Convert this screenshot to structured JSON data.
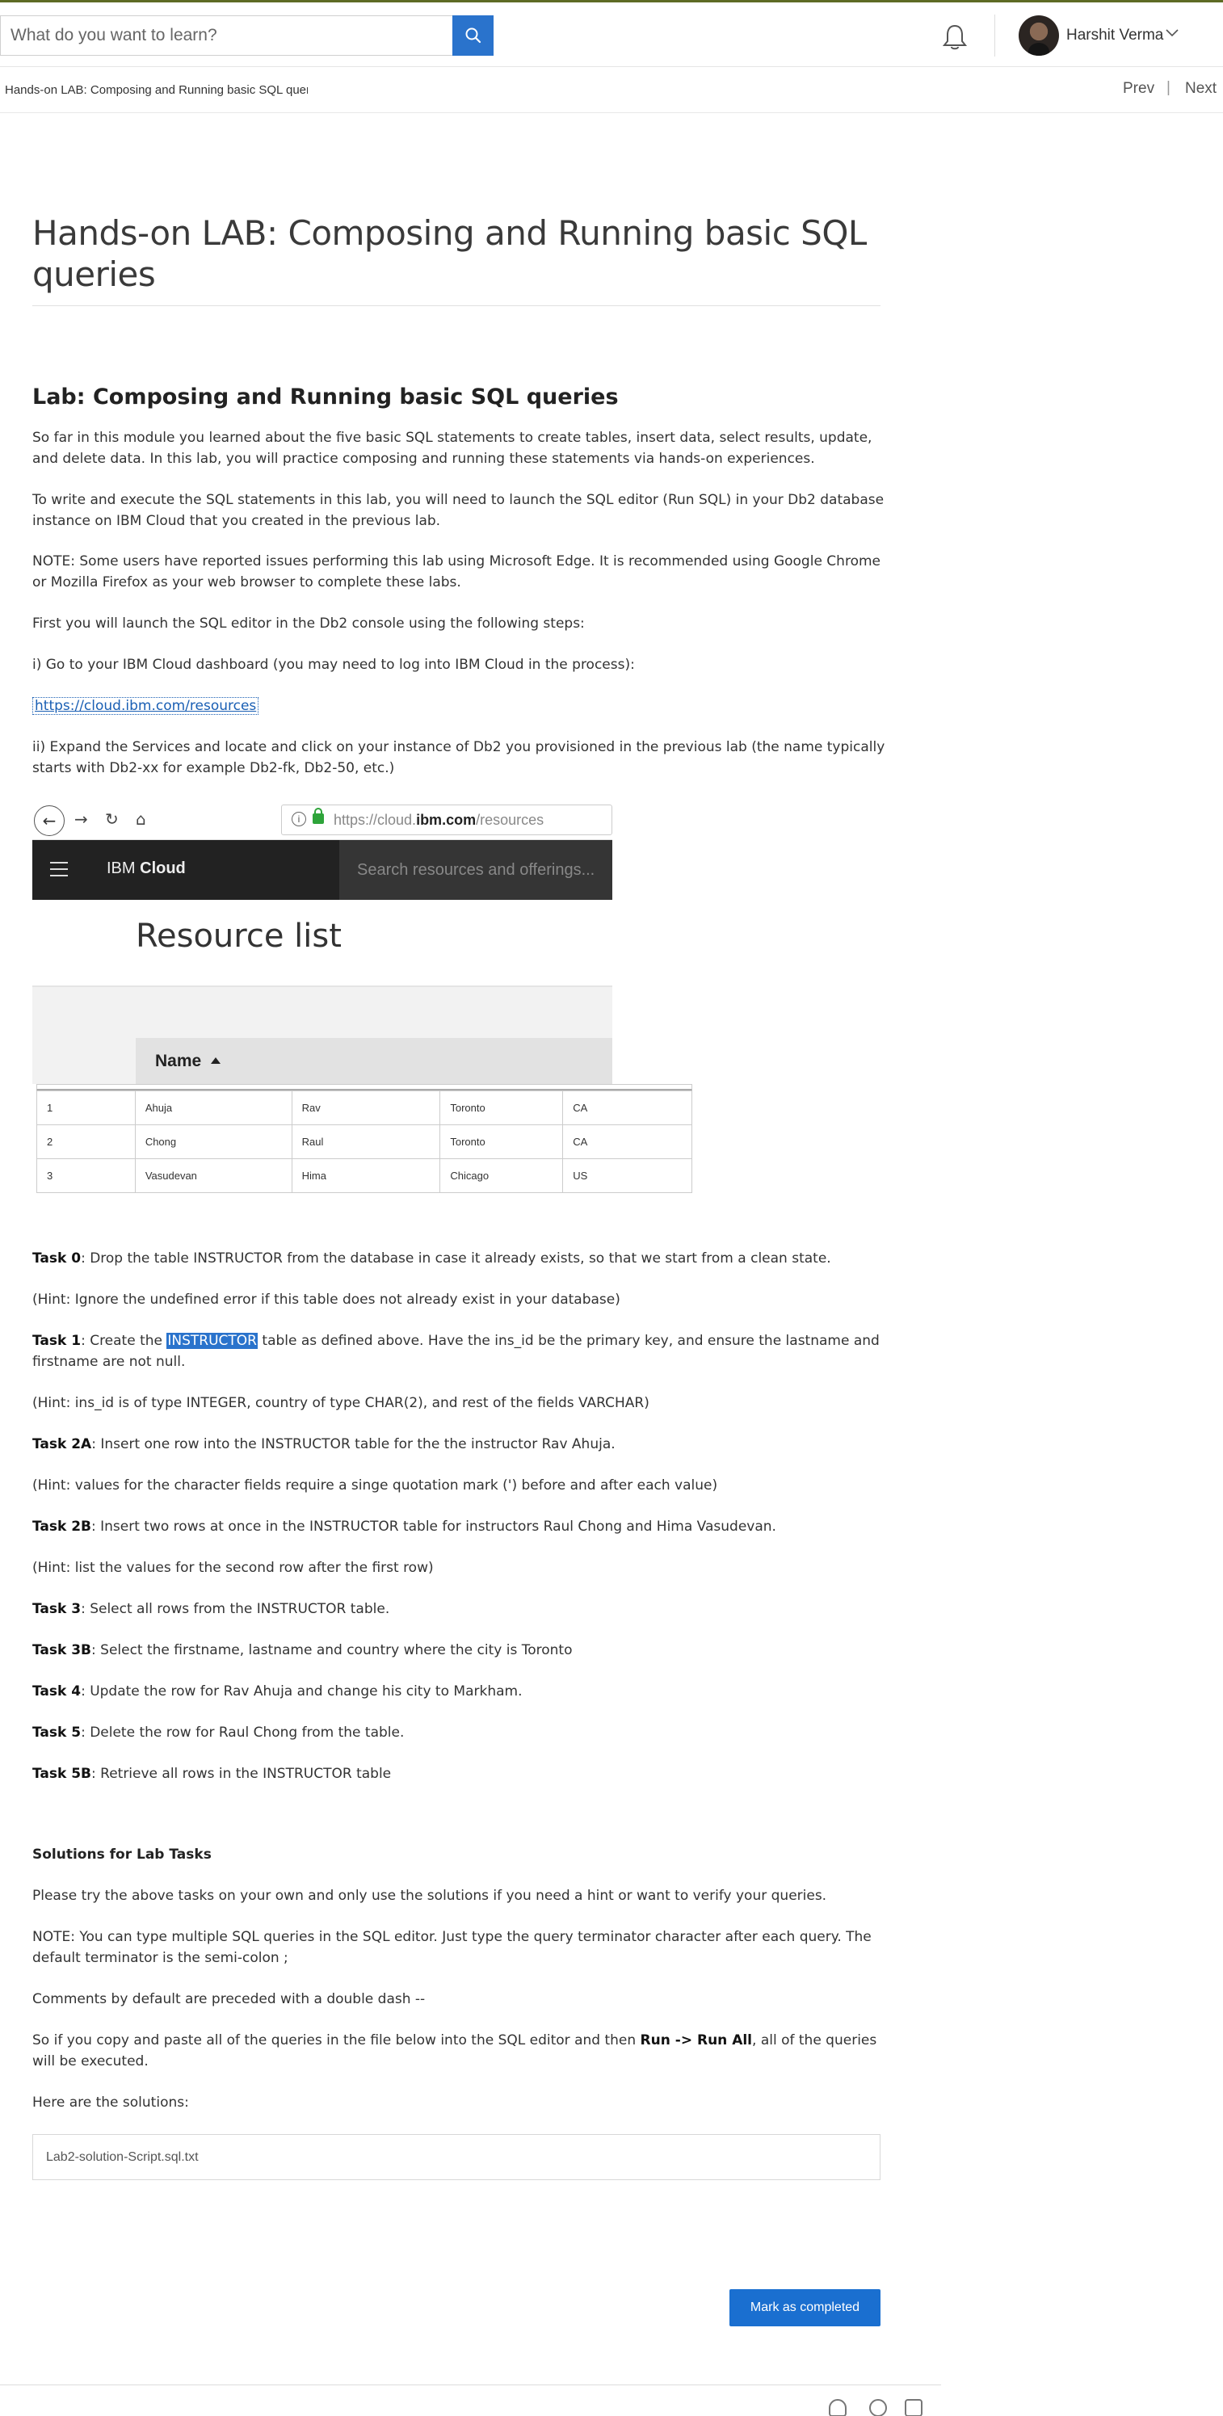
{
  "header": {
    "search_placeholder": "What do you want to learn?",
    "user_name": "Harshit Verma"
  },
  "subbar": {
    "breadcrumb": "Hands-on LAB: Composing and Running basic SQL queries",
    "prev": "Prev",
    "separator": "|",
    "next": "Next"
  },
  "page": {
    "title": "Hands-on LAB: Composing and Running basic SQL queries",
    "lab_heading": "Lab: Composing and Running basic SQL queries",
    "intro": "So far in this module you learned about the five basic SQL statements to create tables, insert data, select results, update, and delete data. In this lab, you will practice composing and running these statements via hands-on experiences.",
    "launch_note": "To write and execute the SQL statements in this lab, you will need to launch the SQL editor (Run SQL) in your Db2 database instance on IBM Cloud that you created in the previous lab.",
    "edge_note": "NOTE: Some users have reported issues performing this lab using Microsoft Edge. It is recommended using Google Chrome or Mozilla Firefox as your web browser to complete these labs.",
    "first_steps": "First you will launch the SQL editor in the Db2 console using the following steps:",
    "step1": "i) Go to your IBM Cloud dashboard (you may need to log into IBM Cloud in the process):",
    "step1_link": "https://cloud.ibm.com/resources",
    "step2": "ii) Expand the Services and locate and click on your instance of Db2 you provisioned in the previous lab (the name typically starts with Db2-xx for example Db2-fk, Db2-50, etc.)"
  },
  "figure": {
    "url_prefix": "https://cloud.",
    "url_bold": "ibm.com",
    "url_suffix": "/resources",
    "brand_prefix": "IBM ",
    "brand_bold": "Cloud",
    "search_placeholder": "Search resources and offerings...",
    "resource_list_title": "Resource list",
    "name_column": "Name",
    "table_rows": [
      [
        "1",
        "Ahuja",
        "Rav",
        "Toronto",
        "CA"
      ],
      [
        "2",
        "Chong",
        "Raul",
        "Toronto",
        "CA"
      ],
      [
        "3",
        "Vasudevan",
        "Hima",
        "Chicago",
        "US"
      ]
    ]
  },
  "tasks": {
    "t0_label": "Task 0",
    "t0_text": ": Drop the table INSTRUCTOR from the database in case it already exists, so that we start from a clean state.",
    "t0_hint": "(Hint: Ignore the undefined error if this table does not already exist in your database)",
    "t1_label": "Task 1",
    "t1_pre": ": Create the ",
    "t1_highlight": "INSTRUCTOR",
    "t1_post": " table as defined above. Have the ins_id be the primary key, and ensure the lastname and firstname are not null.",
    "t1_hint": "(Hint: ins_id is of type INTEGER, country of type CHAR(2), and rest of the fields VARCHAR)",
    "t2a_label": "Task 2A",
    "t2a_text": ": Insert one row into the INSTRUCTOR table for the the instructor Rav Ahuja.",
    "t2a_hint": "(Hint: values for the character fields require a singe quotation mark (') before and after each value)",
    "t2b_label": "Task 2B",
    "t2b_text": ": Insert two rows at once in the INSTRUCTOR table for instructors Raul Chong and Hima Vasudevan.",
    "t2b_hint": "(Hint: list the values for the second row after the first row)",
    "t3_label": "Task 3",
    "t3_text": ": Select all rows from the INSTRUCTOR table.",
    "t3b_label": "Task 3B",
    "t3b_text": ": Select the firstname, lastname and country where the city is Toronto",
    "t4_label": "Task 4",
    "t4_text": ": Update the row for Rav Ahuja and change his city to Markham.",
    "t5_label": "Task 5",
    "t5_text": ": Delete the row for Raul Chong from the table.",
    "t5b_label": "Task 5B",
    "t5b_text": ": Retrieve all rows in the INSTRUCTOR table"
  },
  "solutions": {
    "heading": "Solutions for Lab Tasks",
    "p1": "Please try the above tasks on your own and only use the solutions if you need a hint or want to verify your queries.",
    "p2": "NOTE: You can type multiple SQL queries in the SQL editor. Just type the query terminator character after each query. The default terminator is the semi-colon ;",
    "p3": "Comments by default are preceded with a double dash --",
    "p4_pre": "So if you copy and paste all of the queries in the file below into the SQL editor and then ",
    "p4_bold": "Run -> Run All",
    "p4_post": ", all of the queries will be executed.",
    "p5": "Here are the solutions:",
    "file_name": "Lab2-solution-Script.sql.txt"
  },
  "actions": {
    "mark_completed": "Mark as completed"
  }
}
